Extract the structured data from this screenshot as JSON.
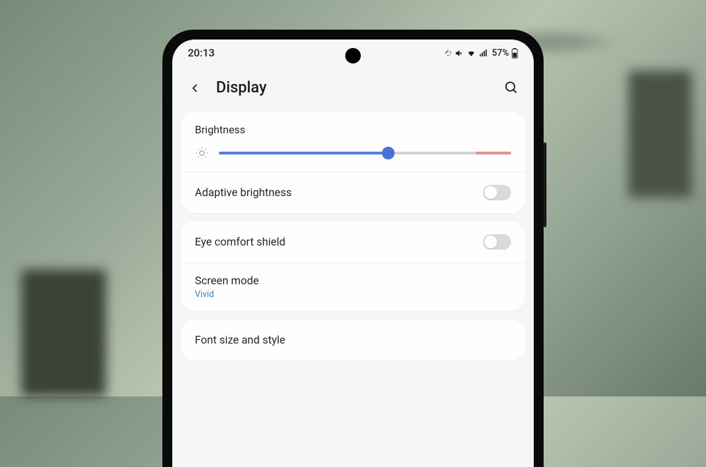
{
  "status": {
    "time": "20:13",
    "battery_pct": "57%"
  },
  "header": {
    "title": "Display"
  },
  "brightness": {
    "label": "Brightness",
    "value_pct": 58
  },
  "adaptive": {
    "label": "Adaptive brightness",
    "on": false
  },
  "eye_comfort": {
    "label": "Eye comfort shield",
    "on": false
  },
  "screen_mode": {
    "label": "Screen mode",
    "value": "Vivid"
  },
  "font": {
    "label": "Font size and style"
  }
}
